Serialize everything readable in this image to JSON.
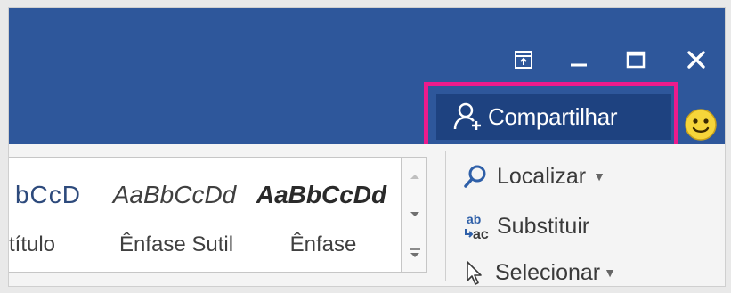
{
  "titlebar": {
    "controls": {
      "ribbon_display": "ribbon-display-options-icon",
      "minimize": "minimize-icon",
      "maximize": "maximize-icon",
      "close": "close-icon"
    },
    "share_button": {
      "label": "Compartilhar",
      "icon": "add-person-icon"
    },
    "feedback_icon": "smiley-icon"
  },
  "ribbon": {
    "styles": [
      {
        "preview": "bCcD",
        "name": "título"
      },
      {
        "preview": "AaBbCcDd",
        "name": "Ênfase Sutil"
      },
      {
        "preview": "AaBbCcDd",
        "name": "Ênfase"
      }
    ],
    "editing": {
      "find_label": "Localizar",
      "replace_label": "Substituir",
      "select_label": "Selecionar"
    }
  },
  "colors": {
    "titlebar": "#2e579b",
    "share_button_bg": "#1e4280",
    "highlight": "#ec1b8c",
    "smiley": "#f6d53a"
  }
}
